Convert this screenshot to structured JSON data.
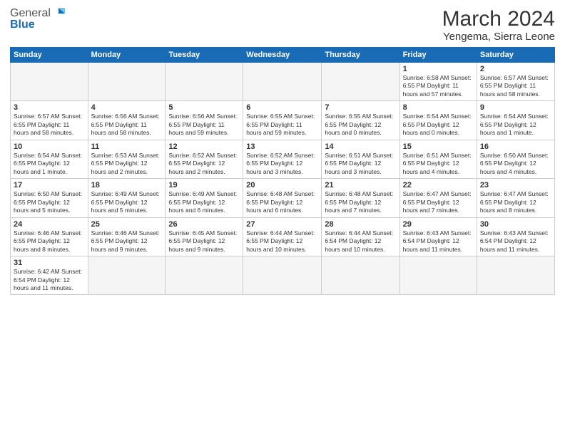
{
  "logo": {
    "text_general": "General",
    "text_blue": "Blue"
  },
  "title": "March 2024",
  "subtitle": "Yengema, Sierra Leone",
  "days_of_week": [
    "Sunday",
    "Monday",
    "Tuesday",
    "Wednesday",
    "Thursday",
    "Friday",
    "Saturday"
  ],
  "weeks": [
    [
      {
        "day": "",
        "info": ""
      },
      {
        "day": "",
        "info": ""
      },
      {
        "day": "",
        "info": ""
      },
      {
        "day": "",
        "info": ""
      },
      {
        "day": "",
        "info": ""
      },
      {
        "day": "1",
        "info": "Sunrise: 6:58 AM\nSunset: 6:55 PM\nDaylight: 11 hours\nand 57 minutes."
      },
      {
        "day": "2",
        "info": "Sunrise: 6:57 AM\nSunset: 6:55 PM\nDaylight: 11 hours\nand 58 minutes."
      }
    ],
    [
      {
        "day": "3",
        "info": "Sunrise: 6:57 AM\nSunset: 6:55 PM\nDaylight: 11 hours\nand 58 minutes."
      },
      {
        "day": "4",
        "info": "Sunrise: 6:56 AM\nSunset: 6:55 PM\nDaylight: 11 hours\nand 58 minutes."
      },
      {
        "day": "5",
        "info": "Sunrise: 6:56 AM\nSunset: 6:55 PM\nDaylight: 11 hours\nand 59 minutes."
      },
      {
        "day": "6",
        "info": "Sunrise: 6:55 AM\nSunset: 6:55 PM\nDaylight: 11 hours\nand 59 minutes."
      },
      {
        "day": "7",
        "info": "Sunrise: 6:55 AM\nSunset: 6:55 PM\nDaylight: 12 hours\nand 0 minutes."
      },
      {
        "day": "8",
        "info": "Sunrise: 6:54 AM\nSunset: 6:55 PM\nDaylight: 12 hours\nand 0 minutes."
      },
      {
        "day": "9",
        "info": "Sunrise: 6:54 AM\nSunset: 6:55 PM\nDaylight: 12 hours\nand 1 minute."
      }
    ],
    [
      {
        "day": "10",
        "info": "Sunrise: 6:54 AM\nSunset: 6:55 PM\nDaylight: 12 hours\nand 1 minute."
      },
      {
        "day": "11",
        "info": "Sunrise: 6:53 AM\nSunset: 6:55 PM\nDaylight: 12 hours\nand 2 minutes."
      },
      {
        "day": "12",
        "info": "Sunrise: 6:52 AM\nSunset: 6:55 PM\nDaylight: 12 hours\nand 2 minutes."
      },
      {
        "day": "13",
        "info": "Sunrise: 6:52 AM\nSunset: 6:55 PM\nDaylight: 12 hours\nand 3 minutes."
      },
      {
        "day": "14",
        "info": "Sunrise: 6:51 AM\nSunset: 6:55 PM\nDaylight: 12 hours\nand 3 minutes."
      },
      {
        "day": "15",
        "info": "Sunrise: 6:51 AM\nSunset: 6:55 PM\nDaylight: 12 hours\nand 4 minutes."
      },
      {
        "day": "16",
        "info": "Sunrise: 6:50 AM\nSunset: 6:55 PM\nDaylight: 12 hours\nand 4 minutes."
      }
    ],
    [
      {
        "day": "17",
        "info": "Sunrise: 6:50 AM\nSunset: 6:55 PM\nDaylight: 12 hours\nand 5 minutes."
      },
      {
        "day": "18",
        "info": "Sunrise: 6:49 AM\nSunset: 6:55 PM\nDaylight: 12 hours\nand 5 minutes."
      },
      {
        "day": "19",
        "info": "Sunrise: 6:49 AM\nSunset: 6:55 PM\nDaylight: 12 hours\nand 6 minutes."
      },
      {
        "day": "20",
        "info": "Sunrise: 6:48 AM\nSunset: 6:55 PM\nDaylight: 12 hours\nand 6 minutes."
      },
      {
        "day": "21",
        "info": "Sunrise: 6:48 AM\nSunset: 6:55 PM\nDaylight: 12 hours\nand 7 minutes."
      },
      {
        "day": "22",
        "info": "Sunrise: 6:47 AM\nSunset: 6:55 PM\nDaylight: 12 hours\nand 7 minutes."
      },
      {
        "day": "23",
        "info": "Sunrise: 6:47 AM\nSunset: 6:55 PM\nDaylight: 12 hours\nand 8 minutes."
      }
    ],
    [
      {
        "day": "24",
        "info": "Sunrise: 6:46 AM\nSunset: 6:55 PM\nDaylight: 12 hours\nand 8 minutes."
      },
      {
        "day": "25",
        "info": "Sunrise: 6:46 AM\nSunset: 6:55 PM\nDaylight: 12 hours\nand 9 minutes."
      },
      {
        "day": "26",
        "info": "Sunrise: 6:45 AM\nSunset: 6:55 PM\nDaylight: 12 hours\nand 9 minutes."
      },
      {
        "day": "27",
        "info": "Sunrise: 6:44 AM\nSunset: 6:55 PM\nDaylight: 12 hours\nand 10 minutes."
      },
      {
        "day": "28",
        "info": "Sunrise: 6:44 AM\nSunset: 6:54 PM\nDaylight: 12 hours\nand 10 minutes."
      },
      {
        "day": "29",
        "info": "Sunrise: 6:43 AM\nSunset: 6:54 PM\nDaylight: 12 hours\nand 11 minutes."
      },
      {
        "day": "30",
        "info": "Sunrise: 6:43 AM\nSunset: 6:54 PM\nDaylight: 12 hours\nand 11 minutes."
      }
    ],
    [
      {
        "day": "31",
        "info": "Sunrise: 6:42 AM\nSunset: 6:54 PM\nDaylight: 12 hours\nand 11 minutes."
      },
      {
        "day": "",
        "info": ""
      },
      {
        "day": "",
        "info": ""
      },
      {
        "day": "",
        "info": ""
      },
      {
        "day": "",
        "info": ""
      },
      {
        "day": "",
        "info": ""
      },
      {
        "day": "",
        "info": ""
      }
    ]
  ]
}
